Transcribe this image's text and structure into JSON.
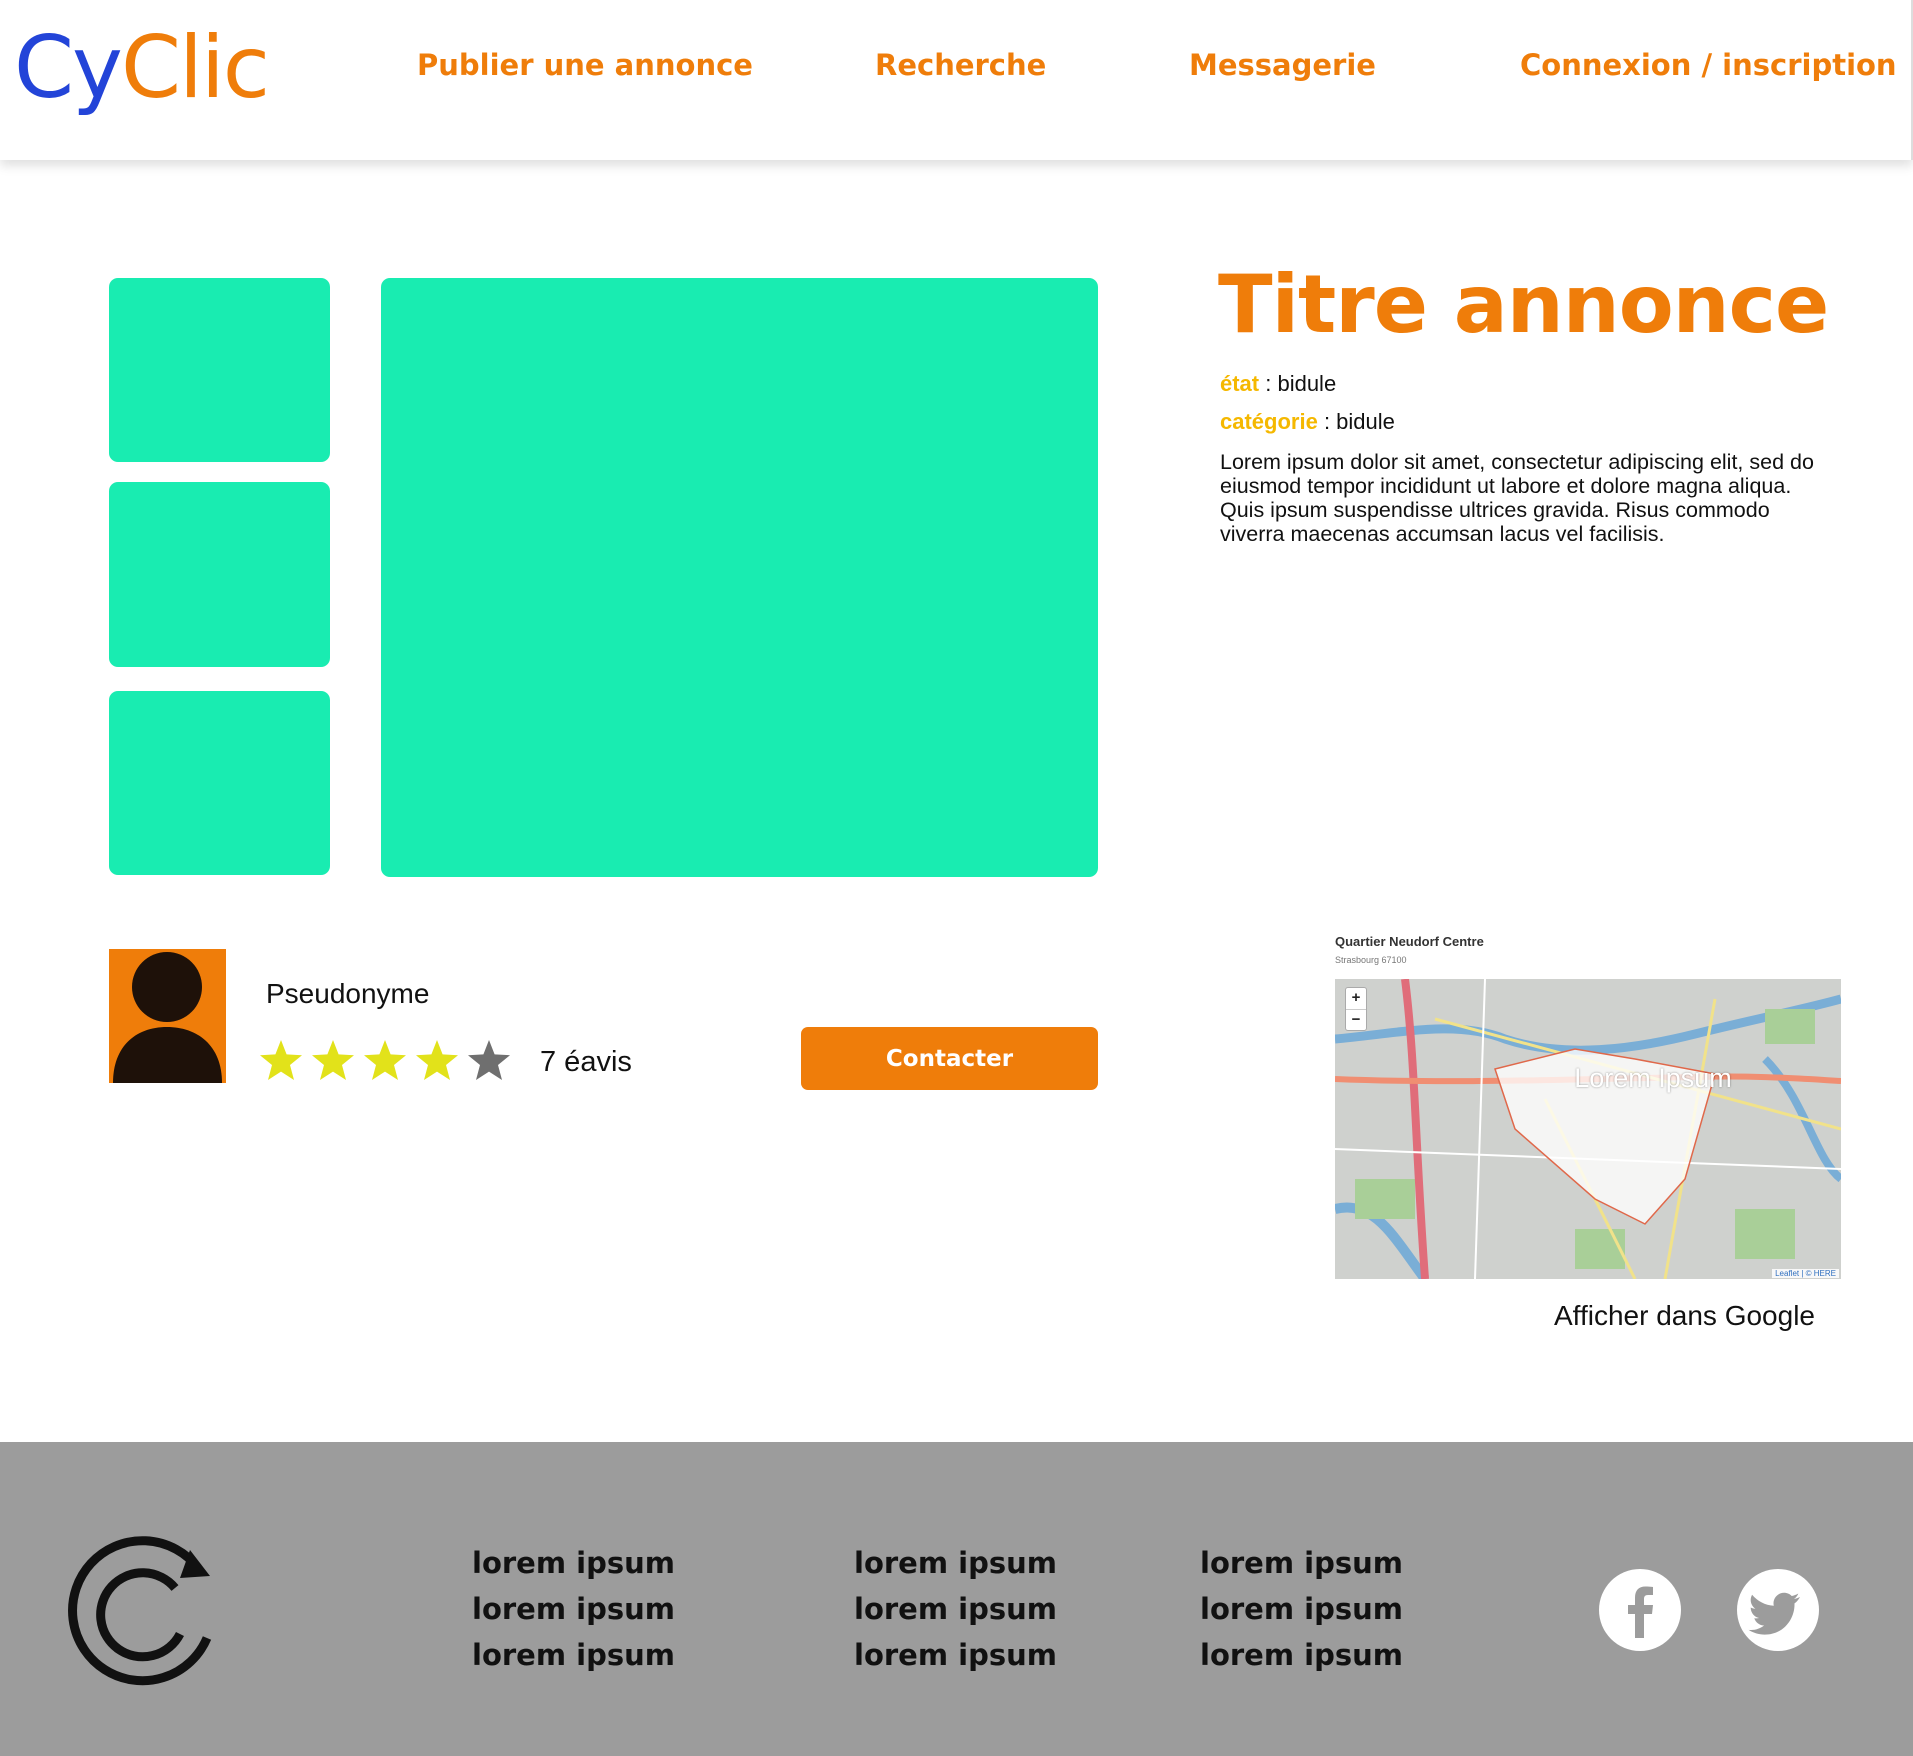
{
  "brand": {
    "logo_part1": "Cy",
    "logo_part2": "Clic",
    "primary_color": "#ef7d0a",
    "secondary_color": "#2344d8",
    "photo_color": "#19ecb1"
  },
  "nav": {
    "publish": "Publier une annonce",
    "search": "Recherche",
    "messages": "Messagerie",
    "login": "Connexion / inscription"
  },
  "listing": {
    "title": "Titre annonce",
    "state_label": "état",
    "state_value": " : bidule",
    "category_label": "catégorie",
    "category_value": " : bidule",
    "description": "Lorem ipsum dolor sit amet, consectetur adipiscing elit, sed do eiusmod tempor incididunt ut labore et dolore magna aliqua. Quis ipsum suspendisse ultrices gravida. Risus commodo viverra maecenas accumsan lacus vel facilisis."
  },
  "seller": {
    "pseudonym": "Pseudonyme",
    "rating": 4,
    "rating_max": 5,
    "reviews": "7 éavis",
    "contact_label": "Contacter"
  },
  "map": {
    "place_name": "Quartier Neudorf Centre",
    "place_sub": "Strasbourg 67100",
    "overlay_text": "Lorem Ipsum",
    "zoom_in": "+",
    "zoom_out": "−",
    "attribution": "Leaflet | © HERE",
    "google_link": "Afficher dans Google"
  },
  "footer": {
    "columns": [
      [
        "lorem ipsum",
        "lorem ipsum",
        "lorem ipsum"
      ],
      [
        "lorem ipsum",
        "lorem ipsum",
        "lorem ipsum"
      ],
      [
        "lorem ipsum",
        "lorem ipsum",
        "lorem ipsum"
      ]
    ],
    "social": [
      "facebook-icon",
      "twitter-icon"
    ]
  }
}
